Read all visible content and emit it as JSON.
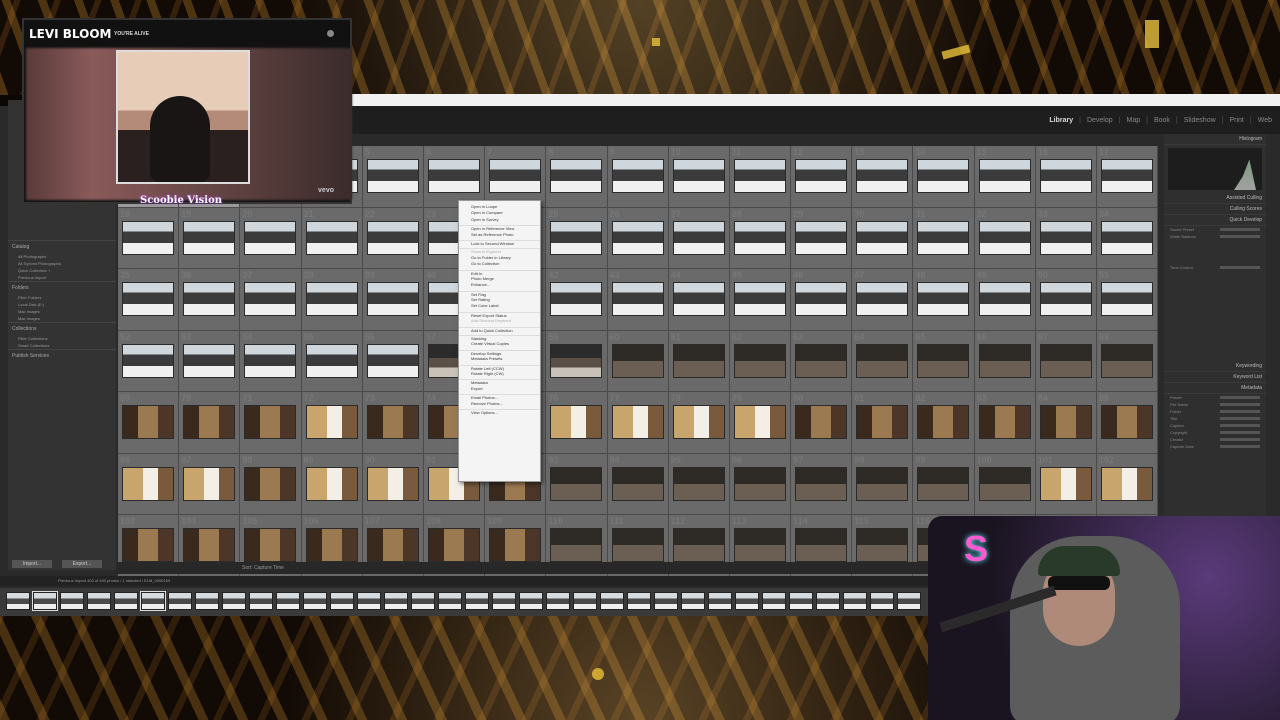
{
  "video": {
    "artist": "LEVI BLOOM",
    "song": "YOU'RE ALIVE",
    "vevo": "vevo",
    "brand": "Scoobie Vision"
  },
  "modules": [
    "Library",
    "Develop",
    "Map",
    "Book",
    "Slideshow",
    "Print",
    "Web"
  ],
  "left_panel": {
    "catalog": "Catalog",
    "catalog_items": [
      "All Photographs",
      "All Synced Photographs",
      "Quick Collection +",
      "Previous Import"
    ],
    "folders": "Folders",
    "folder_items": [
      "Filter Folders",
      "Local Disk (E:)",
      "Mac Images",
      "Mac Images"
    ],
    "collections": "Collections",
    "collection_items": [
      "Filter Collections",
      "Smart Collections"
    ],
    "publish": "Publish Services",
    "import": "Import...",
    "export": "Export..."
  },
  "grid": {
    "row_numbers": [
      1,
      18,
      35,
      52,
      69,
      86,
      103
    ],
    "rows": [
      [
        "sel",
        "sel",
        "snow",
        "snow",
        "snow",
        "snow",
        "snow",
        "snow",
        "snow",
        "snow",
        "snow",
        "snow",
        "snow",
        "snow",
        "snow",
        "snow",
        "snow"
      ],
      [
        "snow",
        "snow",
        "snow",
        "snow",
        "snow",
        "snow",
        "snow",
        "snow",
        "snow",
        "snow",
        "snow",
        "snow",
        "snow",
        "snow",
        "snow",
        "snow",
        "snow"
      ],
      [
        "snow",
        "snow",
        "snow",
        "snow",
        "snow",
        "snow",
        "snow",
        "snow",
        "snow",
        "snow",
        "snow",
        "snow",
        "snow",
        "snow",
        "snow",
        "snow",
        "snow"
      ],
      [
        "snow",
        "snow",
        "snow",
        "snow",
        "snow",
        "dark",
        "dark",
        "dark",
        "room",
        "room",
        "room",
        "room",
        "room",
        "room",
        "room",
        "room",
        "room"
      ],
      [
        "int",
        "int",
        "int",
        "bath",
        "int",
        "int",
        "int",
        "bath",
        "bath",
        "bath",
        "bath",
        "int",
        "int",
        "int",
        "int",
        "int",
        "int"
      ],
      [
        "bath",
        "bath",
        "int",
        "bath",
        "bath",
        "bath",
        "int",
        "room",
        "room",
        "room",
        "room",
        "room",
        "room",
        "room",
        "room",
        "bath",
        "bath"
      ],
      [
        "int",
        "int",
        "int",
        "int",
        "int",
        "int",
        "int",
        "room",
        "room",
        "room",
        "room",
        "room",
        "room",
        "room",
        "room",
        "room",
        "room"
      ]
    ]
  },
  "context_menu": [
    {
      "label": "Open in Loupe",
      "disabled": false
    },
    {
      "label": "Open in Compare",
      "disabled": false
    },
    {
      "label": "Open in Survey",
      "disabled": false
    },
    {
      "label": "Open in Reference View",
      "disabled": false
    },
    {
      "label": "Set as Reference Photo",
      "disabled": false
    },
    {
      "label": "Lock to Second Window",
      "disabled": false
    },
    {
      "label": "Show in Explorer",
      "disabled": true
    },
    {
      "label": "Go to Folder in Library",
      "disabled": false
    },
    {
      "label": "Go to Collection",
      "disabled": false
    },
    {
      "label": "Edit In",
      "disabled": false
    },
    {
      "label": "Photo Merge",
      "disabled": false
    },
    {
      "label": "Enhance...",
      "disabled": false
    },
    {
      "label": "Set Flag",
      "disabled": false
    },
    {
      "label": "Set Rating",
      "disabled": false
    },
    {
      "label": "Set Color Label",
      "disabled": false
    },
    {
      "label": "Reset Export Status",
      "disabled": false
    },
    {
      "label": "Add Shortcut Keyword",
      "disabled": true
    },
    {
      "label": "Add to Quick Collection",
      "disabled": false
    },
    {
      "label": "Stacking",
      "disabled": false
    },
    {
      "label": "Create Virtual Copies",
      "disabled": false
    },
    {
      "label": "Develop Settings",
      "disabled": false
    },
    {
      "label": "Metadata Presets",
      "disabled": false
    },
    {
      "label": "Rotate Left (CCW)",
      "disabled": false
    },
    {
      "label": "Rotate Right (CW)",
      "disabled": false
    },
    {
      "label": "Metadata",
      "disabled": false
    },
    {
      "label": "Export",
      "disabled": false
    },
    {
      "label": "Email Photos...",
      "disabled": false
    },
    {
      "label": "Remove Photos...",
      "disabled": false
    },
    {
      "label": "View Options...",
      "disabled": false
    }
  ],
  "right_panel": {
    "histogram": "Histogram",
    "assisted_culling": "Assisted Culling",
    "culling_scores": "Culling Scores",
    "quick_develop": "Quick Develop",
    "saved_preset": "Saved Preset",
    "white_balance": "White Balance",
    "tone_control": "Tone Control",
    "keywording": "Keywording",
    "keyword_list": "Keyword List",
    "metadata": "Metadata",
    "meta_rows": [
      "Preset",
      "File Name",
      "Folder",
      "Title",
      "Caption",
      "Copyright",
      "Creator",
      "Capture Date"
    ]
  },
  "toolbar": {
    "sort": "Sort: Capture Time"
  },
  "filmbar": {
    "info": "Previous Import  400 of 400 photos / 1 selected / ELM_0000169"
  }
}
